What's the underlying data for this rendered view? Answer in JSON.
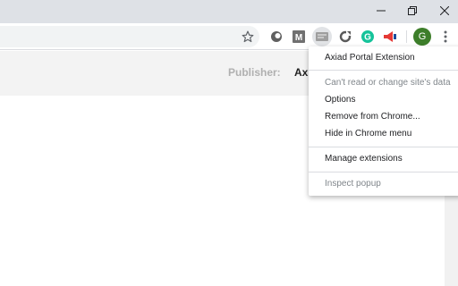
{
  "window_controls": {
    "minimize": "minimize",
    "restore": "restore",
    "close": "close"
  },
  "toolbar": {
    "icons": [
      "bookmark-star-icon",
      "extension-circle-icon",
      "extension-m-icon",
      "axiad-portal-extension-icon",
      "extension-refresh-icon",
      "grammarly-icon",
      "megaphone-icon"
    ],
    "avatar_letter": "G",
    "avatar_color": "#3d7e2a",
    "menu_icon": "kebab-menu-icon"
  },
  "page": {
    "publisher_label": "Publisher:",
    "publisher_value": "Ax"
  },
  "context_menu": {
    "title": "Axiad Portal Extension",
    "site_access": "Can't read or change site's data",
    "options": "Options",
    "remove": "Remove from Chrome...",
    "hide": "Hide in Chrome menu",
    "manage": "Manage extensions",
    "inspect": "Inspect popup"
  },
  "colors": {
    "titlebar": "#dee1e6",
    "page_header": "#f3f3f3",
    "accent_green": "#15c39a",
    "megaphone_red": "#e53935",
    "megaphone_blue": "#1a4d9c"
  }
}
